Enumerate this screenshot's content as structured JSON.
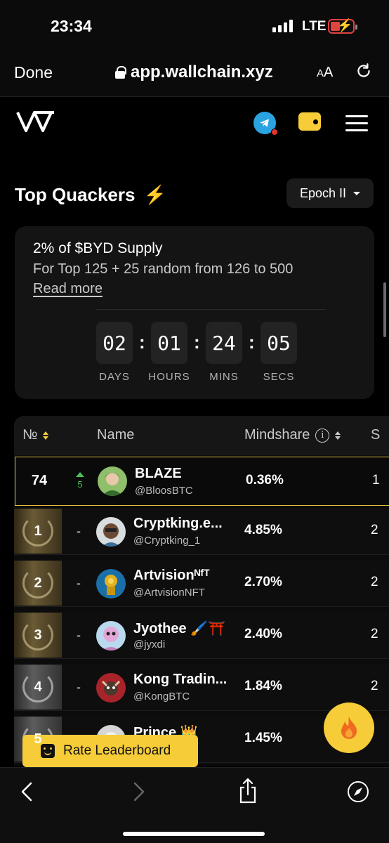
{
  "status": {
    "time": "23:34",
    "network": "LTE"
  },
  "browser": {
    "done_label": "Done",
    "url": "app.wallchain.xyz",
    "text_size_label": "A",
    "text_size_label_big": "A"
  },
  "page": {
    "title": "Top Quackers",
    "epoch_label": "Epoch II",
    "reward": {
      "headline": "2% of $BYD Supply",
      "description": "For Top 125 + 25 random from 126 to 500",
      "read_more": "Read more"
    },
    "countdown": [
      {
        "value": "02",
        "label": "DAYS"
      },
      {
        "value": "01",
        "label": "HOURS"
      },
      {
        "value": "24",
        "label": "MINS"
      },
      {
        "value": "05",
        "label": "SECS"
      }
    ],
    "table": {
      "columns": {
        "rank": "№",
        "name": "Name",
        "mindshare": "Mindshare",
        "next": "S"
      },
      "rows": [
        {
          "rank": "74",
          "change": "5",
          "name": "BLAZE",
          "handle": "@BloosBTC",
          "mindshare": "0.36%",
          "next": "1",
          "highlight": true
        },
        {
          "rank": "1",
          "change": "-",
          "name": "Cryptking.e...",
          "handle": "@Cryptking_1",
          "mindshare": "4.85%",
          "next": "2"
        },
        {
          "rank": "2",
          "change": "-",
          "name": "Artvisionᴺᶠᵀ",
          "handle": "@ArtvisionNFT",
          "mindshare": "2.70%",
          "next": "2"
        },
        {
          "rank": "3",
          "change": "-",
          "name": "Jyothee 🖌️⛩️",
          "handle": "@jyxdi",
          "mindshare": "2.40%",
          "next": "2"
        },
        {
          "rank": "4",
          "change": "-",
          "name": "Kong Tradin...",
          "handle": "@KongBTC",
          "mindshare": "1.84%",
          "next": "2"
        },
        {
          "rank": "5",
          "change": "-",
          "name": "Prince 👑",
          "handle": "",
          "mindshare": "1.45%",
          "next": ""
        }
      ]
    },
    "rate_button": "Rate Leaderboard"
  },
  "colors": {
    "accent": "#f6cc39",
    "positive": "#4bbf5a",
    "card": "#141414"
  }
}
